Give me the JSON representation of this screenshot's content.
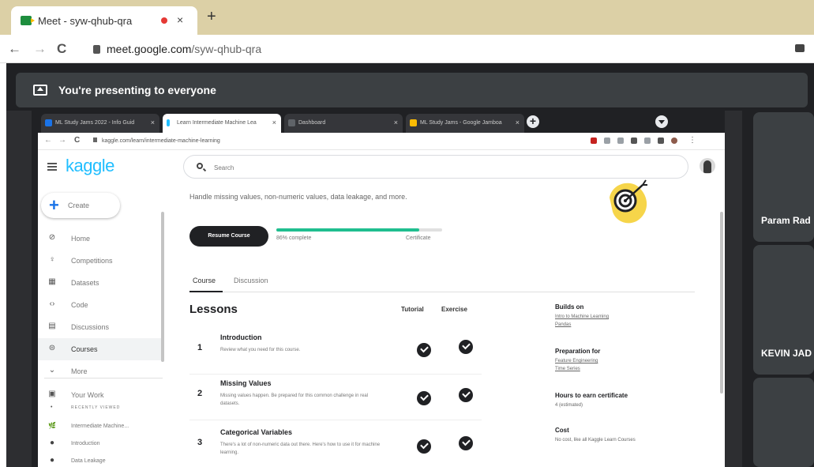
{
  "browser": {
    "tab_title": "Meet - syw-qhub-qra",
    "tab_close": "×",
    "new_tab": "+",
    "url_domain": "meet.google.com",
    "url_path": "/syw-qhub-qra",
    "nav": {
      "back": "←",
      "forward": "→",
      "reload": "C"
    }
  },
  "meet": {
    "presenting_text": "You're presenting to everyone",
    "participants": [
      {
        "name": "Param Rad"
      },
      {
        "name": "KEVIN JAD"
      }
    ]
  },
  "shared_browser": {
    "tabs": [
      {
        "title": "ML Study Jams 2022 - Info Guid",
        "close": "×",
        "color": "#1a73e8"
      },
      {
        "title": "Learn Intermediate Machine Lea",
        "close": "×",
        "color": "#20beff"
      },
      {
        "title": "Dashboard",
        "close": "×",
        "color": "#5f6368"
      },
      {
        "title": "ML Study Jams - Google Jamboa",
        "close": "×",
        "color": "#fbbc04"
      }
    ],
    "new_tab": "+",
    "url": "kaggle.com/learn/intermediate-machine-learning",
    "nav": {
      "back": "←",
      "forward": "→",
      "reload": "C"
    }
  },
  "kaggle": {
    "logo": "kaggle",
    "create_label": "Create",
    "create_plus": "+",
    "nav": [
      {
        "label": "Home",
        "icon": "⊘"
      },
      {
        "label": "Competitions",
        "icon": "♀"
      },
      {
        "label": "Datasets",
        "icon": "▦"
      },
      {
        "label": "Code",
        "icon": "‹›"
      },
      {
        "label": "Discussions",
        "icon": "▤"
      },
      {
        "label": "Courses",
        "icon": "⊜"
      },
      {
        "label": "More",
        "icon": "⌄"
      },
      {
        "label": "Your Work",
        "icon": "▣"
      }
    ],
    "recently_viewed_label": "RECENTLY VIEWED",
    "recent": [
      {
        "label": "Intermediate Machine...",
        "icon": "🌿"
      },
      {
        "label": "Introduction",
        "icon": "●"
      },
      {
        "label": "Data Leakage",
        "icon": "●"
      }
    ],
    "search_placeholder": "Search",
    "course_description": "Handle missing values, non-numeric values, data leakage, and more.",
    "resume_button": "Resume Course",
    "progress_percent": 86,
    "progress_label": "86% complete",
    "certificate_label": "Certificate",
    "tabs": [
      {
        "label": "Course"
      },
      {
        "label": "Discussion"
      }
    ],
    "lessons_title": "Lessons",
    "col_tutorial": "Tutorial",
    "col_exercise": "Exercise",
    "lessons": [
      {
        "num": "1",
        "title": "Introduction",
        "desc": "Review what you need for this course."
      },
      {
        "num": "2",
        "title": "Missing Values",
        "desc": "Missing values happen. Be prepared for this common challenge in real datasets."
      },
      {
        "num": "3",
        "title": "Categorical Variables",
        "desc": "There's a lot of non-numeric data out there. Here's how to use it for machine learning."
      }
    ],
    "sidebar_info": {
      "builds_on_heading": "Builds on",
      "builds_on": [
        "Intro to Machine Learning",
        "Pandas"
      ],
      "prep_heading": "Preparation for",
      "prep": [
        "Feature Engineering",
        "Time Series"
      ],
      "hours_heading": "Hours to earn certificate",
      "hours": "4 (estimated)",
      "cost_heading": "Cost",
      "cost": "No cost, like all Kaggle Learn Courses"
    },
    "accent": "#20beff",
    "progress_color": "#20be8f"
  }
}
